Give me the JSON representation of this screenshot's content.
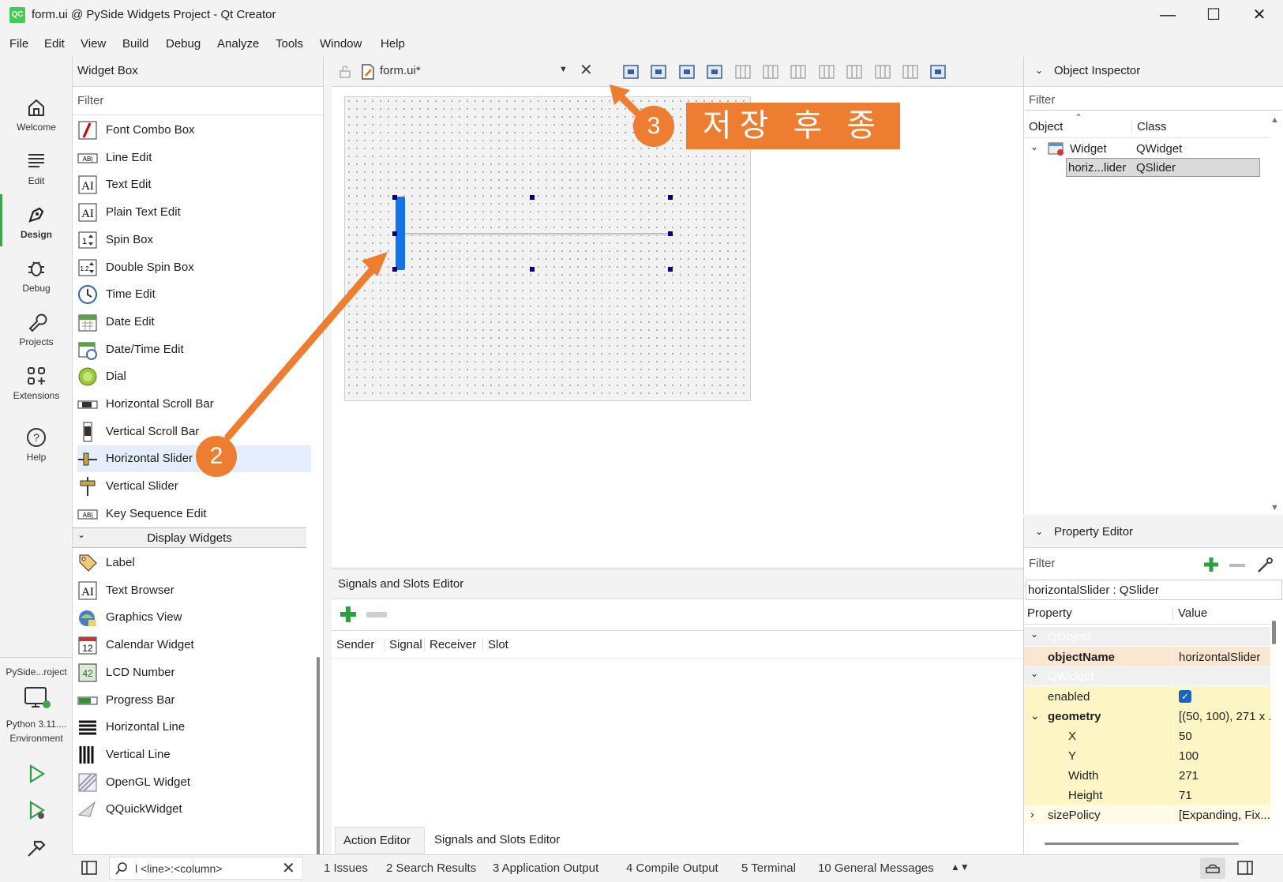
{
  "window": {
    "title": "form.ui @ PySide Widgets Project - Qt Creator",
    "logo": "QC",
    "controls": [
      "minimize-icon",
      "maximize-icon",
      "close-icon"
    ]
  },
  "menu": [
    "File",
    "Edit",
    "View",
    "Build",
    "Debug",
    "Analyze",
    "Tools",
    "Window",
    "Help"
  ],
  "modes": [
    {
      "label": "Welcome",
      "icon": "home-icon"
    },
    {
      "label": "Edit",
      "icon": "lines-icon"
    },
    {
      "label": "Design",
      "icon": "pen-icon"
    },
    {
      "label": "Debug",
      "icon": "bug-icon"
    },
    {
      "label": "Projects",
      "icon": "wrench-icon"
    },
    {
      "label": "Extensions",
      "icon": "grid-plus-icon"
    },
    {
      "label": "Help",
      "icon": "question-icon"
    }
  ],
  "kit": {
    "project": "PySide...roject",
    "env_line1": "Python 3.11....",
    "env_line2": "Environment"
  },
  "widget_box": {
    "title": "Widget Box",
    "filter_placeholder": "Filter",
    "items": [
      {
        "label": "Font Combo Box",
        "icon": "font-combo-icon"
      },
      {
        "label": "Line Edit",
        "icon": "line-edit-icon"
      },
      {
        "label": "Text Edit",
        "icon": "text-edit-icon"
      },
      {
        "label": "Plain Text Edit",
        "icon": "plain-text-edit-icon"
      },
      {
        "label": "Spin Box",
        "icon": "spin-box-icon"
      },
      {
        "label": "Double Spin Box",
        "icon": "double-spin-box-icon"
      },
      {
        "label": "Time Edit",
        "icon": "clock-icon"
      },
      {
        "label": "Date Edit",
        "icon": "calendar-icon"
      },
      {
        "label": "Date/Time Edit",
        "icon": "calendar-clock-icon"
      },
      {
        "label": "Dial",
        "icon": "dial-icon"
      },
      {
        "label": "Horizontal Scroll Bar",
        "icon": "hscrollbar-icon"
      },
      {
        "label": "Vertical Scroll Bar",
        "icon": "vscrollbar-icon"
      },
      {
        "label": "Horizontal Slider",
        "icon": "hslider-icon"
      },
      {
        "label": "Vertical Slider",
        "icon": "vslider-icon"
      },
      {
        "label": "Key Sequence Edit",
        "icon": "key-sequence-icon"
      }
    ],
    "section": "Display Widgets",
    "display_items": [
      {
        "label": "Label",
        "icon": "label-tag-icon"
      },
      {
        "label": "Text Browser",
        "icon": "text-browser-icon"
      },
      {
        "label": "Graphics View",
        "icon": "graphics-view-icon"
      },
      {
        "label": "Calendar Widget",
        "icon": "calendar-widget-icon"
      },
      {
        "label": "LCD Number",
        "icon": "lcd-icon"
      },
      {
        "label": "Progress Bar",
        "icon": "progress-bar-icon"
      },
      {
        "label": "Horizontal Line",
        "icon": "hline-icon"
      },
      {
        "label": "Vertical Line",
        "icon": "vline-icon"
      },
      {
        "label": "OpenGL Widget",
        "icon": "opengl-icon"
      },
      {
        "label": "QQuickWidget",
        "icon": "quick-widget-icon"
      }
    ]
  },
  "editor": {
    "file_name": "form.ui*",
    "calendar_number": "12",
    "lcd_digits": "42"
  },
  "signals_slots": {
    "title": "Signals and Slots Editor",
    "columns": [
      "Sender",
      "Signal",
      "Receiver",
      "Slot"
    ],
    "tabs": [
      "Action Editor",
      "Signals and Slots Editor"
    ]
  },
  "object_inspector": {
    "title": "Object Inspector",
    "filter_placeholder": "Filter",
    "columns": [
      "Object",
      "Class"
    ],
    "rows": [
      {
        "object": "Widget",
        "class": "QWidget"
      },
      {
        "object": "horiz...lider",
        "class": "QSlider"
      }
    ]
  },
  "property_editor": {
    "title": "Property Editor",
    "filter_placeholder": "Filter",
    "context": "horizontalSlider : QSlider",
    "columns": [
      "Property",
      "Value"
    ],
    "group_qobject": "QObject",
    "group_qwidget": "QWidget",
    "rows": [
      {
        "key": "objectName",
        "value": "horizontalSlider"
      },
      {
        "key": "enabled",
        "value": ""
      },
      {
        "key": "geometry",
        "value": "[(50, 100), 271 x ..."
      },
      {
        "key": "X",
        "value": "50"
      },
      {
        "key": "Y",
        "value": "100"
      },
      {
        "key": "Width",
        "value": "271"
      },
      {
        "key": "Height",
        "value": "71"
      },
      {
        "key": "sizePolicy",
        "value": "[Expanding, Fix..."
      }
    ],
    "enabled_checked": true
  },
  "status_bar": {
    "locator_placeholder": "l <line>:<column>",
    "tabs": [
      "1  Issues",
      "2  Search Results",
      "3  Application Output",
      "4  Compile Output",
      "5  Terminal",
      "10  General Messages"
    ]
  },
  "annotations": {
    "step2": "2",
    "step3": "3",
    "step3_label": "저장 후 종료",
    "color": "#ed7d31"
  }
}
